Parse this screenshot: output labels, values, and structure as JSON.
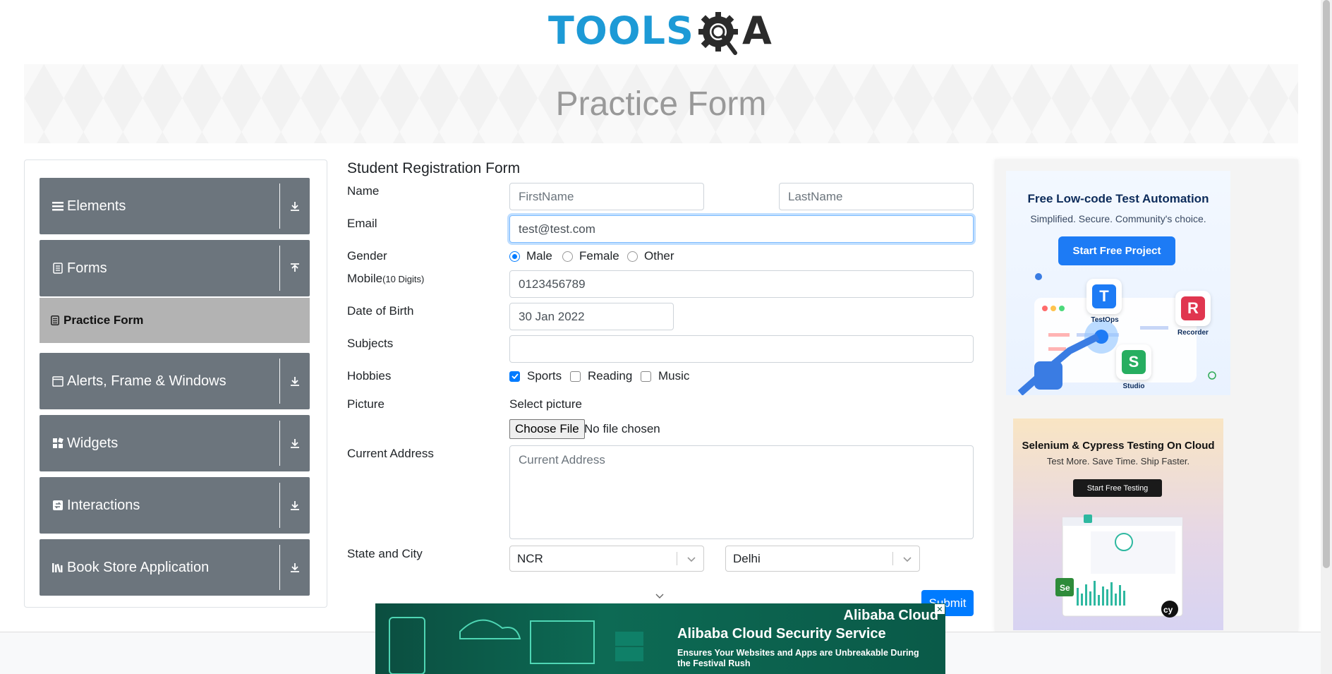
{
  "header": {
    "logo_text": "TOOLS",
    "logo_suffix": "A"
  },
  "banner": {
    "title": "Practice Form"
  },
  "sidebar": {
    "groups": [
      {
        "label": "Elements",
        "icon": "menu-icon",
        "expanded": false
      },
      {
        "label": "Forms",
        "icon": "document-icon",
        "expanded": true
      },
      {
        "label": "Alerts, Frame & Windows",
        "icon": "window-icon",
        "expanded": false
      },
      {
        "label": "Widgets",
        "icon": "widgets-icon",
        "expanded": false
      },
      {
        "label": "Interactions",
        "icon": "interactions-icon",
        "expanded": false
      },
      {
        "label": "Book Store Application",
        "icon": "books-icon",
        "expanded": false
      }
    ],
    "active_item": "Practice Form"
  },
  "form": {
    "title": "Student Registration Form",
    "name_label": "Name",
    "first_name_placeholder": "FirstName",
    "last_name_placeholder": "LastName",
    "email_label": "Email",
    "email_value": "test@test.com",
    "gender_label": "Gender",
    "gender_options": [
      "Male",
      "Female",
      "Other"
    ],
    "gender_selected": "Male",
    "mobile_label": "Mobile",
    "mobile_hint": "(10 Digits)",
    "mobile_value": "0123456789",
    "dob_label": "Date of Birth",
    "dob_value": "30 Jan 2022",
    "subjects_label": "Subjects",
    "subjects_value": "",
    "hobbies_label": "Hobbies",
    "hobbies": [
      {
        "label": "Sports",
        "checked": true
      },
      {
        "label": "Reading",
        "checked": false
      },
      {
        "label": "Music",
        "checked": false
      }
    ],
    "picture_label": "Picture",
    "select_picture": "Select picture",
    "choose_file": "Choose File",
    "no_file": "No file chosen",
    "address_label": "Current Address",
    "address_placeholder": "Current Address",
    "state_city_label": "State and City",
    "state_value": "NCR",
    "city_value": "Delhi",
    "submit_label": "Submit"
  },
  "ads": {
    "ad1": {
      "title": "Free Low-code Test Automation",
      "subtitle": "Simplified. Secure. Community's choice.",
      "button": "Start Free Project",
      "labels": [
        "TestOps",
        "Recorder",
        "Studio"
      ]
    },
    "ad2": {
      "title": "Selenium & Cypress Testing On Cloud",
      "subtitle": "Test More. Save Time. Ship Faster.",
      "button": "Start Free Testing"
    },
    "bottom": {
      "brand": "Alibaba Cloud",
      "headline": "Alibaba Cloud Security Service",
      "text": "Ensures Your Websites and Apps are Unbreakable During the Festival Rush"
    }
  },
  "colors": {
    "accent": "#007bff",
    "sidebar_group": "#6c757d",
    "sidebar_active": "#b3b3b3",
    "logo_blue": "#1d9ad6"
  }
}
